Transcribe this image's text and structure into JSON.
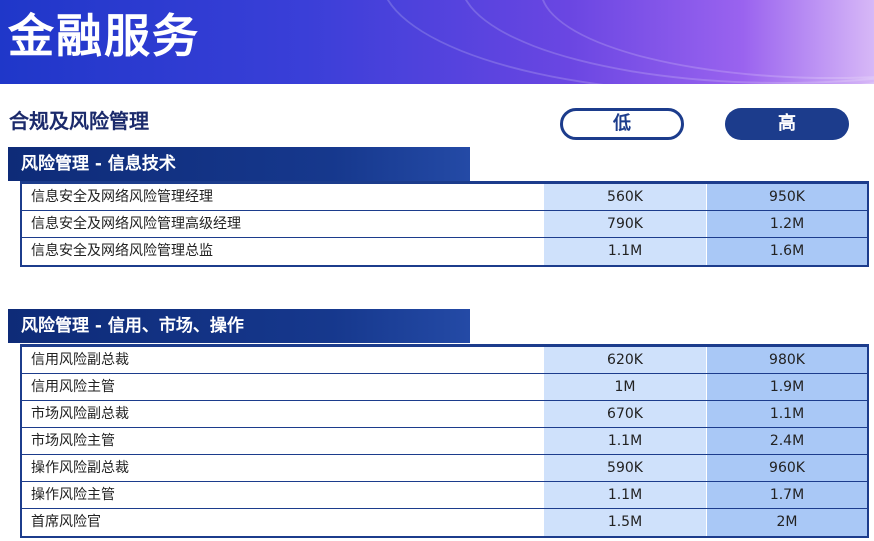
{
  "page": {
    "title": "金融服务",
    "subtitle": "合规及风险管理",
    "level_low": "低",
    "level_high": "高"
  },
  "sections": [
    {
      "title": "风险管理 - 信息技术",
      "rows": [
        {
          "role": "信息安全及网络风险管理经理",
          "low": "560K",
          "high": "950K"
        },
        {
          "role": "信息安全及网络风险管理高级经理",
          "low": "790K",
          "high": "1.2M"
        },
        {
          "role": "信息安全及网络风险管理总监",
          "low": "1.1M",
          "high": "1.6M"
        }
      ]
    },
    {
      "title": "风险管理 - 信用、市场、操作",
      "rows": [
        {
          "role": "信用风险副总裁",
          "low": "620K",
          "high": "980K"
        },
        {
          "role": "信用风险主管",
          "low": "1M",
          "high": "1.9M"
        },
        {
          "role": "市场风险副总裁",
          "low": "670K",
          "high": "1.1M"
        },
        {
          "role": "市场风险主管",
          "low": "1.1M",
          "high": "2.4M"
        },
        {
          "role": "操作风险副总裁",
          "low": "590K",
          "high": "960K"
        },
        {
          "role": "操作风险主管",
          "low": "1.1M",
          "high": "1.7M"
        },
        {
          "role": "首席风险官",
          "low": "1.5M",
          "high": "2M"
        }
      ]
    }
  ],
  "colors": {
    "navy": "#1c3c8c",
    "low_column": "#cfe1fb",
    "high_column": "#a9c8f6",
    "banner_start": "#1f37c9",
    "banner_end": "#d7b8f7"
  }
}
